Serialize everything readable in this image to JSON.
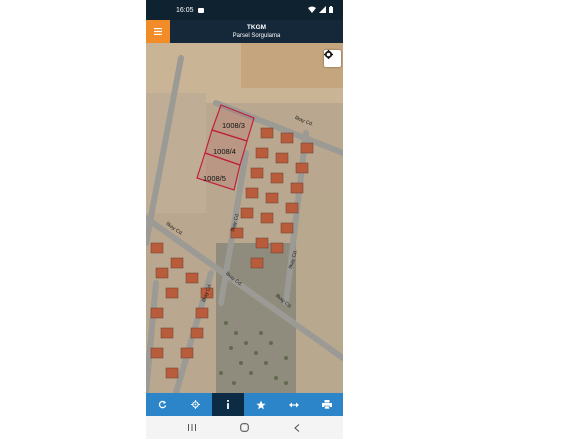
{
  "status_bar": {
    "time": "16:05",
    "icons": [
      "image-icon",
      "wifi-icon",
      "signal-icon",
      "battery-icon"
    ]
  },
  "header": {
    "title": "TKGM",
    "subtitle": "Parsel Sorgulama",
    "menu_icon": "hamburger-menu-icon",
    "accent_color": "#f28c28",
    "background_color": "#14283a"
  },
  "map": {
    "settings_icon": "gear-icon",
    "parcels": [
      {
        "label": "1008/3"
      },
      {
        "label": "1008/4"
      },
      {
        "label": "1008/5"
      }
    ],
    "parcel_outline_color": "#c0203a",
    "streets": [
      {
        "label": "İlkay Cd."
      },
      {
        "label": "İlkay Cd."
      },
      {
        "label": "İlkay Cd."
      },
      {
        "label": "İlkay Cd."
      },
      {
        "label": "İlkay Cd."
      },
      {
        "label": "İlkay Cd."
      },
      {
        "label": "İlkay Cd."
      }
    ]
  },
  "toolbar": {
    "background_color": "#2c85c8",
    "active_color": "#0c2b44",
    "tools": [
      {
        "name": "refresh-icon"
      },
      {
        "name": "locate-icon"
      },
      {
        "name": "info-icon",
        "active": true
      },
      {
        "name": "star-icon"
      },
      {
        "name": "measure-icon"
      },
      {
        "name": "print-icon"
      }
    ]
  },
  "nav_bar": {
    "buttons": [
      "recents-icon",
      "home-icon",
      "back-icon"
    ]
  }
}
